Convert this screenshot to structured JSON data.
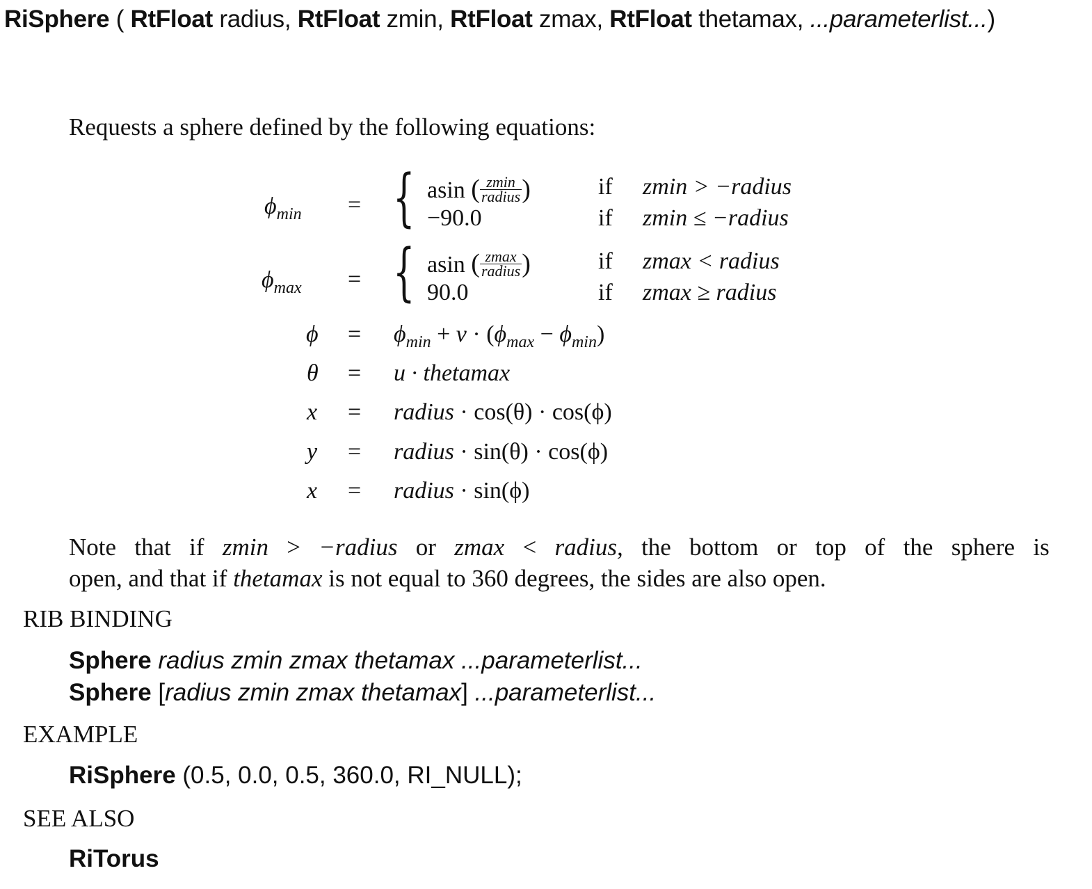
{
  "signature": {
    "func": "RiSphere",
    "open_paren": " ( ",
    "type": "RtFloat",
    "p1": " radius, ",
    "p2": " zmin, ",
    "p3": " zmax, ",
    "p4": " thetamax, ",
    "params": "...parameterlist...",
    "close_paren": ")"
  },
  "intro": "Requests a sphere defined by the following equations:",
  "equations": {
    "phi": "ϕ",
    "theta": "θ",
    "eq": "=",
    "min": "min",
    "max": "max",
    "asin": "asin",
    "lparen": "(",
    "rparen": ")",
    "brace": "{",
    "frac_zmin": "zmin",
    "frac_zmax": "zmax",
    "frac_radius": "radius",
    "neg90": "−90.0",
    "pos90": "90.0",
    "if": "if",
    "cond_min1": "zmin > −radius",
    "cond_min2": "zmin ≤ −radius",
    "cond_max1": "zmax < radius",
    "cond_max2": "zmax ≥ radius",
    "phi_rhs_a": " + ",
    "phi_rhs_v": "v",
    "phi_rhs_b": " · (",
    "phi_rhs_minus": " − ",
    "phi_rhs_c": ")",
    "theta_rhs": "u · thetamax",
    "x_lhs": "x",
    "y_lhs": "y",
    "z_lhs": "x",
    "x_rhs_r": "radius",
    "x_rhs": " · cos(θ) · cos(ϕ)",
    "y_rhs": " · sin(θ) · cos(ϕ)",
    "z_rhs": " · sin(ϕ)"
  },
  "note": {
    "w1": "Note",
    "w2": "that",
    "w3": "if",
    "w4": "zmin",
    "w5": ">",
    "w6": "−radius",
    "w7": "or",
    "w8": "zmax",
    "w9": "<",
    "w10": "radius,",
    "w11": "the",
    "w12": "bottom",
    "w13": "or",
    "w14": "top",
    "w15": "of",
    "w16": "the",
    "w17": "sphere",
    "w18": "is",
    "line2_a": "open, and that if ",
    "line2_b": "thetamax",
    "line2_c": " is not equal to 360 degrees, the sides are also open."
  },
  "rib_binding": {
    "header": "RIB BINDING",
    "keyword": "Sphere",
    "line1_args": " radius zmin zmax thetamax ...parameterlist...",
    "line2_open": " [",
    "line2_args": "radius zmin zmax thetamax",
    "line2_close": "] ",
    "line2_params": "...parameterlist..."
  },
  "example": {
    "header": "EXAMPLE",
    "func": "RiSphere",
    "args": " (0.5, 0.0, 0.5, 360.0, RI_NULL);"
  },
  "see_also": {
    "header": "SEE ALSO",
    "item": "RiTorus"
  }
}
